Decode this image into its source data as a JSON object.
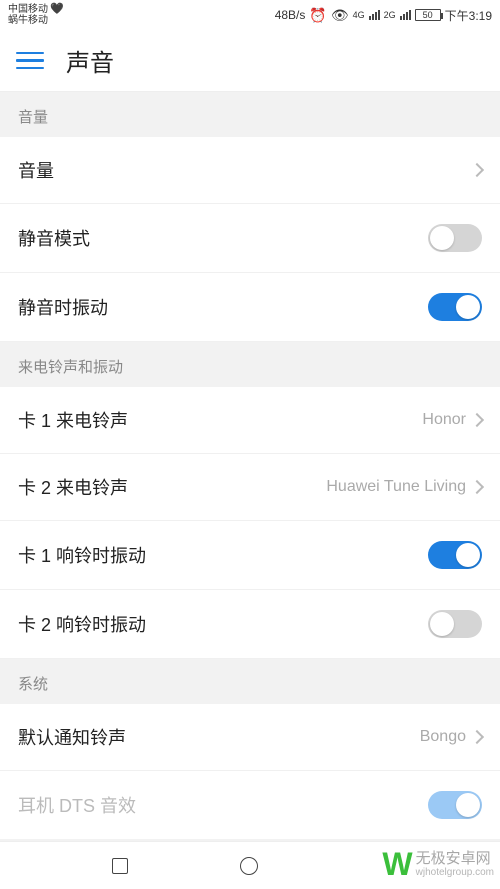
{
  "statusbar": {
    "carrier1": "中国移动",
    "carrier2": "蜗牛移动",
    "speed": "48B/s",
    "network1": "4G",
    "network2": "2G",
    "battery": "50",
    "time": "下午3:19"
  },
  "header": {
    "title": "声音"
  },
  "sections": {
    "volume_header": "音量",
    "ringtone_header": "来电铃声和振动",
    "system_header": "系统"
  },
  "rows": {
    "volume": "音量",
    "silent_mode": "静音模式",
    "vibrate_when_silent": "静音时振动",
    "sim1_ringtone": "卡 1 来电铃声",
    "sim1_ringtone_value": "Honor",
    "sim2_ringtone": "卡 2 来电铃声",
    "sim2_ringtone_value": "Huawei Tune Living",
    "sim1_vibrate": "卡 1 响铃时振动",
    "sim2_vibrate": "卡 2 响铃时振动",
    "default_notification": "默认通知铃声",
    "default_notification_value": "Bongo",
    "dts": "耳机 DTS 音效"
  },
  "switches": {
    "silent_mode": false,
    "vibrate_when_silent": true,
    "sim1_vibrate": true,
    "sim2_vibrate": false,
    "dts": true
  },
  "watermark": {
    "brand": "无极安卓网",
    "url": "wjhotelgroup.com"
  }
}
